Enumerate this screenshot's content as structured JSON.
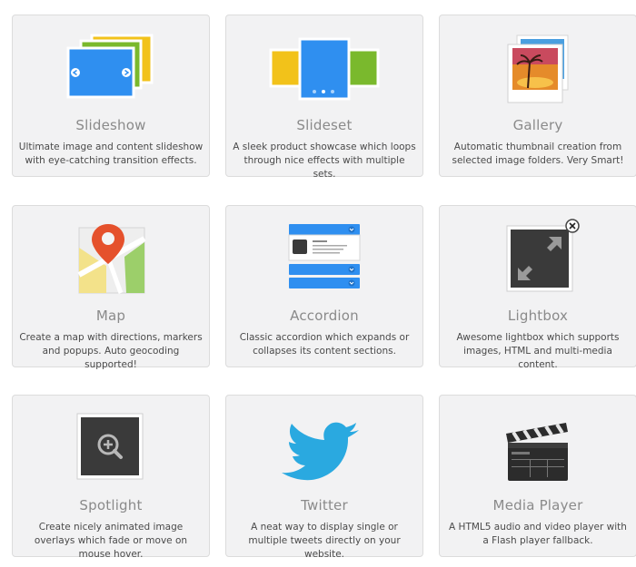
{
  "cards": [
    {
      "title": "Slideshow",
      "description": "Ultimate image and content slideshow with eye-catching transition effects.",
      "icon": "slideshow-icon"
    },
    {
      "title": "Slideset",
      "description": "A sleek product showcase which loops through nice effects with multiple sets.",
      "icon": "slideset-icon"
    },
    {
      "title": "Gallery",
      "description": "Automatic thumbnail creation from selected image folders. Very Smart!",
      "icon": "gallery-icon"
    },
    {
      "title": "Map",
      "description": "Create a map with directions, markers and popups. Auto geocoding supported!",
      "icon": "map-icon"
    },
    {
      "title": "Accordion",
      "description": "Classic accordion which expands or collapses its content sections.",
      "icon": "accordion-icon"
    },
    {
      "title": "Lightbox",
      "description": "Awesome lightbox which supports images, HTML and multi-media content.",
      "icon": "lightbox-icon"
    },
    {
      "title": "Spotlight",
      "description": "Create nicely animated image overlays which fade or move on mouse hover.",
      "icon": "spotlight-icon"
    },
    {
      "title": "Twitter",
      "description": "A neat way to display single or multiple tweets directly on your website.",
      "icon": "twitter-icon"
    },
    {
      "title": "Media Player",
      "description": "A HTML5 audio and video player with a Flash player fallback.",
      "icon": "media-player-icon"
    }
  ],
  "colors": {
    "card_bg": "#f2f2f3",
    "accent_blue": "#2b8de8",
    "map_pin": "#e5512c",
    "twitter_blue": "#2aa9e0"
  }
}
